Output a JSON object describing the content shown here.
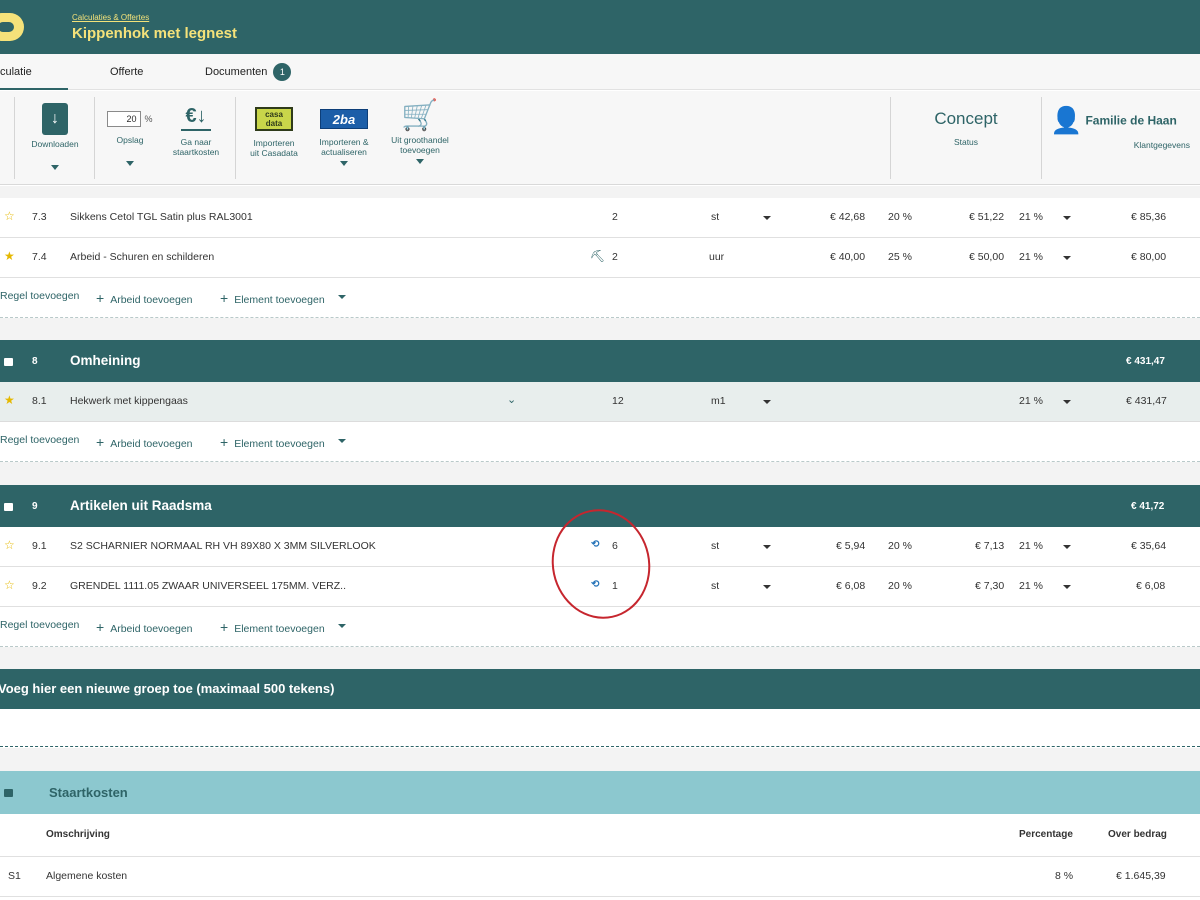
{
  "header": {
    "breadcrumb": "Calculaties & Offertes",
    "title": "Kippenhok met legnest"
  },
  "tabs": [
    {
      "label": "culatie",
      "active": true
    },
    {
      "label": "Offerte"
    },
    {
      "label": "Documenten",
      "badge": "1"
    }
  ],
  "toolbar": {
    "downloaden": "Downloaden",
    "opslag_value": "20",
    "opslag_unit": "%",
    "opslag": "Opslag",
    "staartkosten_l1": "Ga naar",
    "staartkosten_l2": "staartkosten",
    "casadata_l1": "Importeren",
    "casadata_l2": "uit Casadata",
    "casadata_logo": "casa data",
    "b2ba_l1": "Importeren &",
    "b2ba_l2": "actualiseren",
    "b2ba_logo": "2ba",
    "groothandel_l1": "Uit groothandel",
    "groothandel_l2": "toevoegen",
    "status_value": "Concept",
    "status_label": "Status",
    "client_name": "Familie de Haan",
    "client_label": "Klantgegevens"
  },
  "add_bar": {
    "regel": "Regel toevoegen",
    "arbeid": "Arbeid toevoegen",
    "element": "Element toevoegen"
  },
  "rows_7": [
    {
      "nr": "7.3",
      "desc": "Sikkens Cetol TGL Satin plus RAL3001",
      "qty": "2",
      "unit": "st",
      "price": "€ 42,68",
      "markup": "20 %",
      "sale": "€ 51,22",
      "vat": "21 %",
      "total": "€ 85,36"
    },
    {
      "nr": "7.4",
      "desc": "Arbeid - Schuren en schilderen",
      "qty": "2",
      "unit": "uur",
      "price": "€ 40,00",
      "markup": "25 %",
      "sale": "€ 50,00",
      "vat": "21 %",
      "total": "€ 80,00"
    }
  ],
  "group_8": {
    "nr": "8",
    "title": "Omheining",
    "total": "€ 431,47"
  },
  "row_81": {
    "nr": "8.1",
    "desc": "Hekwerk met kippengaas",
    "qty": "12",
    "unit": "m1",
    "vat": "21 %",
    "total": "€ 431,47"
  },
  "group_9": {
    "nr": "9",
    "title": "Artikelen uit Raadsma",
    "total": "€ 41,72"
  },
  "rows_9": [
    {
      "nr": "9.1",
      "desc": "S2 SCHARNIER NORMAAL RH VH 89X80 X 3MM SILVERLOOK",
      "qty": "6",
      "unit": "st",
      "price": "€ 5,94",
      "markup": "20 %",
      "sale": "€ 7,13",
      "vat": "21 %",
      "total": "€ 35,64"
    },
    {
      "nr": "9.2",
      "desc": "GRENDEL 1111.05 ZWAAR UNIVERSEEL  175MM. VERZ..",
      "qty": "1",
      "unit": "st",
      "price": "€ 6,08",
      "markup": "20 %",
      "sale": "€ 7,30",
      "vat": "21 %",
      "total": "€ 6,08"
    }
  ],
  "new_group_placeholder": "Voeg hier een nieuwe groep toe (maximaal 500 tekens)",
  "staartkosten": {
    "title": "Staartkosten",
    "col_desc": "Omschrijving",
    "col_pct": "Percentage",
    "col_amount": "Over bedrag",
    "rows": [
      {
        "nr": "S1",
        "desc": "Algemene kosten",
        "pct": "8 %",
        "amount": "€ 1.645,39"
      }
    ]
  },
  "colors": {
    "primary": "#2e6467",
    "accent": "#f5e27a",
    "staart": "#8cc8cf",
    "annotation": "#c6262e"
  }
}
